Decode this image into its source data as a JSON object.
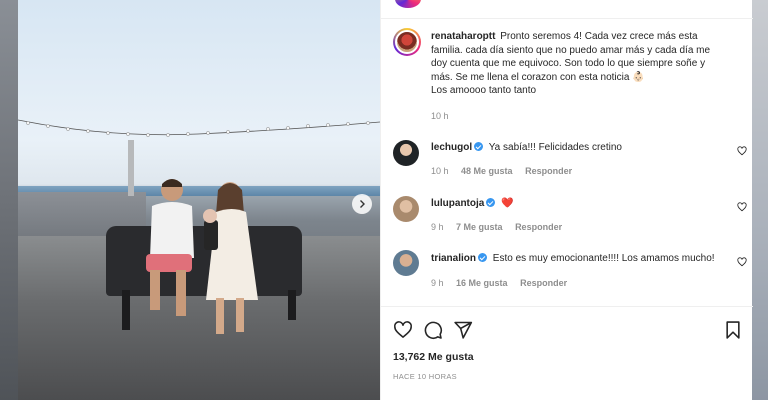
{
  "post": {
    "author": "renataharoptt",
    "caption_lines": [
      "Pronto seremos 4! Cada vez crece más esta",
      "familia. cada día siento que no puedo amar más y cada día me",
      "doy cuenta que me equivoco. Son todo lo que siempre soñe y",
      "más. Se me llena el corazon con esta noticia 👶🏻",
      "Los amoooo tanto tanto"
    ],
    "caption_time": "10 h",
    "likes_count": "13,762",
    "likes_label": "Me gusta",
    "posted_ago": "HACE 10 HORAS"
  },
  "comments": [
    {
      "user": "lechugol",
      "verified": true,
      "text": "Ya sabía!!! Felicidades cretino",
      "time": "10 h",
      "likes": "48 Me gusta",
      "reply": "Responder",
      "avatar_color": "#1f2326"
    },
    {
      "user": "lulupantoja",
      "verified": true,
      "text": "❤️",
      "time": "9 h",
      "likes": "7 Me gusta",
      "reply": "Responder",
      "avatar_color": "#b89b7e"
    },
    {
      "user": "trianalion",
      "verified": true,
      "text": "Esto es muy emocionante!!!! Los amamos mucho!",
      "time": "9 h",
      "likes": "16 Me gusta",
      "reply": "Responder",
      "avatar_color": "#5f7b92"
    }
  ],
  "icons": {
    "like": "heart-icon",
    "comment": "comment-icon",
    "share": "share-icon",
    "save": "bookmark-icon",
    "next": "chevron-right-icon"
  },
  "colors": {
    "verified": "#3897f0",
    "text": "#262626",
    "muted": "#8e8e8e"
  }
}
